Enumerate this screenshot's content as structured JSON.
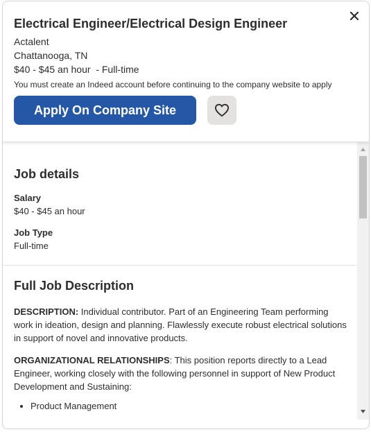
{
  "job": {
    "title": "Electrical Engineer/Electrical Design Engineer",
    "company": "Actalent",
    "location": "Chattanooga, TN",
    "pay": "$40 - $45 an hour",
    "type_separator": "- Full-time",
    "account_note": "You must create an Indeed account before continuing to the company website to apply"
  },
  "actions": {
    "apply_label": "Apply On Company Site",
    "save_icon": "heart-icon",
    "close_icon": "close-icon"
  },
  "details": {
    "heading": "Job details",
    "salary_label": "Salary",
    "salary_value": "$40 - $45 an hour",
    "jobtype_label": "Job Type",
    "jobtype_value": "Full-time"
  },
  "description": {
    "heading": "Full Job Description",
    "p1_label": "DESCRIPTION:",
    "p1_text": " Individual contributor. Part of an Engineering Team performing work in ideation, design and planning. Flawlessly execute robust electrical solutions in support of novel and innovative products.",
    "p2_label": "ORGANIZATIONAL RELATIONSHIPS",
    "p2_text": ": This position reports directly to a Lead Engineer, working closely with the following personnel in support of New Product Development and Sustaining:",
    "bullets": [
      "Product Management"
    ]
  },
  "colors": {
    "primary": "#2557a7",
    "text": "#2d2d2d",
    "save_bg": "#e4e2e0"
  }
}
